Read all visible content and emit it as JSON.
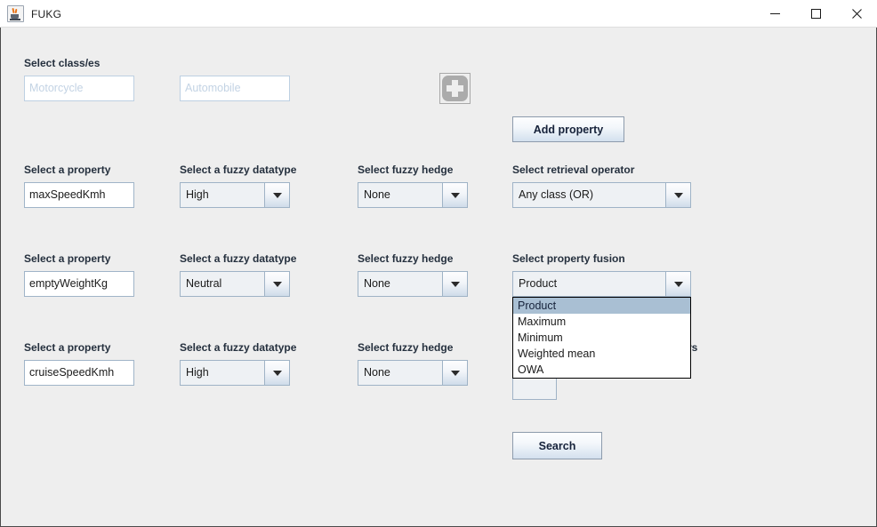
{
  "window": {
    "title": "FUKG",
    "app_icon": "java-coffee-cup-icon",
    "controls": {
      "minimize": "minimize-icon",
      "maximize": "maximize-icon",
      "close": "close-icon"
    }
  },
  "classes_section": {
    "label": "Select class/es",
    "inputs": [
      {
        "value": "",
        "placeholder": "Motorcycle"
      },
      {
        "value": "",
        "placeholder": "Automobile"
      }
    ],
    "add_class_icon": "plus-icon"
  },
  "add_property_button": "Add property",
  "search_button": "Search",
  "labels": {
    "property": "Select a property",
    "datatype": "Select a fuzzy datatype",
    "hedge": "Select fuzzy hedge",
    "retrieval_operator": "Select retrieval operator",
    "property_fusion": "Select property fusion",
    "obscured_label_tail": "rs"
  },
  "rows": [
    {
      "property": "maxSpeedKmh",
      "datatype": "High",
      "hedge": "None"
    },
    {
      "property": "emptyWeightKg",
      "datatype": "Neutral",
      "hedge": "None"
    },
    {
      "property": "cruiseSpeedKmh",
      "datatype": "High",
      "hedge": "None"
    }
  ],
  "retrieval_operator": {
    "selected": "Any class (OR)"
  },
  "property_fusion": {
    "selected": "Product",
    "open": true,
    "options": [
      "Product",
      "Maximum",
      "Minimum",
      "Weighted mean",
      "OWA"
    ],
    "selected_index": 0
  },
  "colors": {
    "window_background": "#eeeeee",
    "titlebar": "#ffffff",
    "input_border": "#a0b4c8",
    "placeholder_text": "#c3d3e4",
    "button_accent": "#d3e0ee",
    "dropdown_highlight": "#a9bfd3",
    "label_text": "#25303e"
  }
}
